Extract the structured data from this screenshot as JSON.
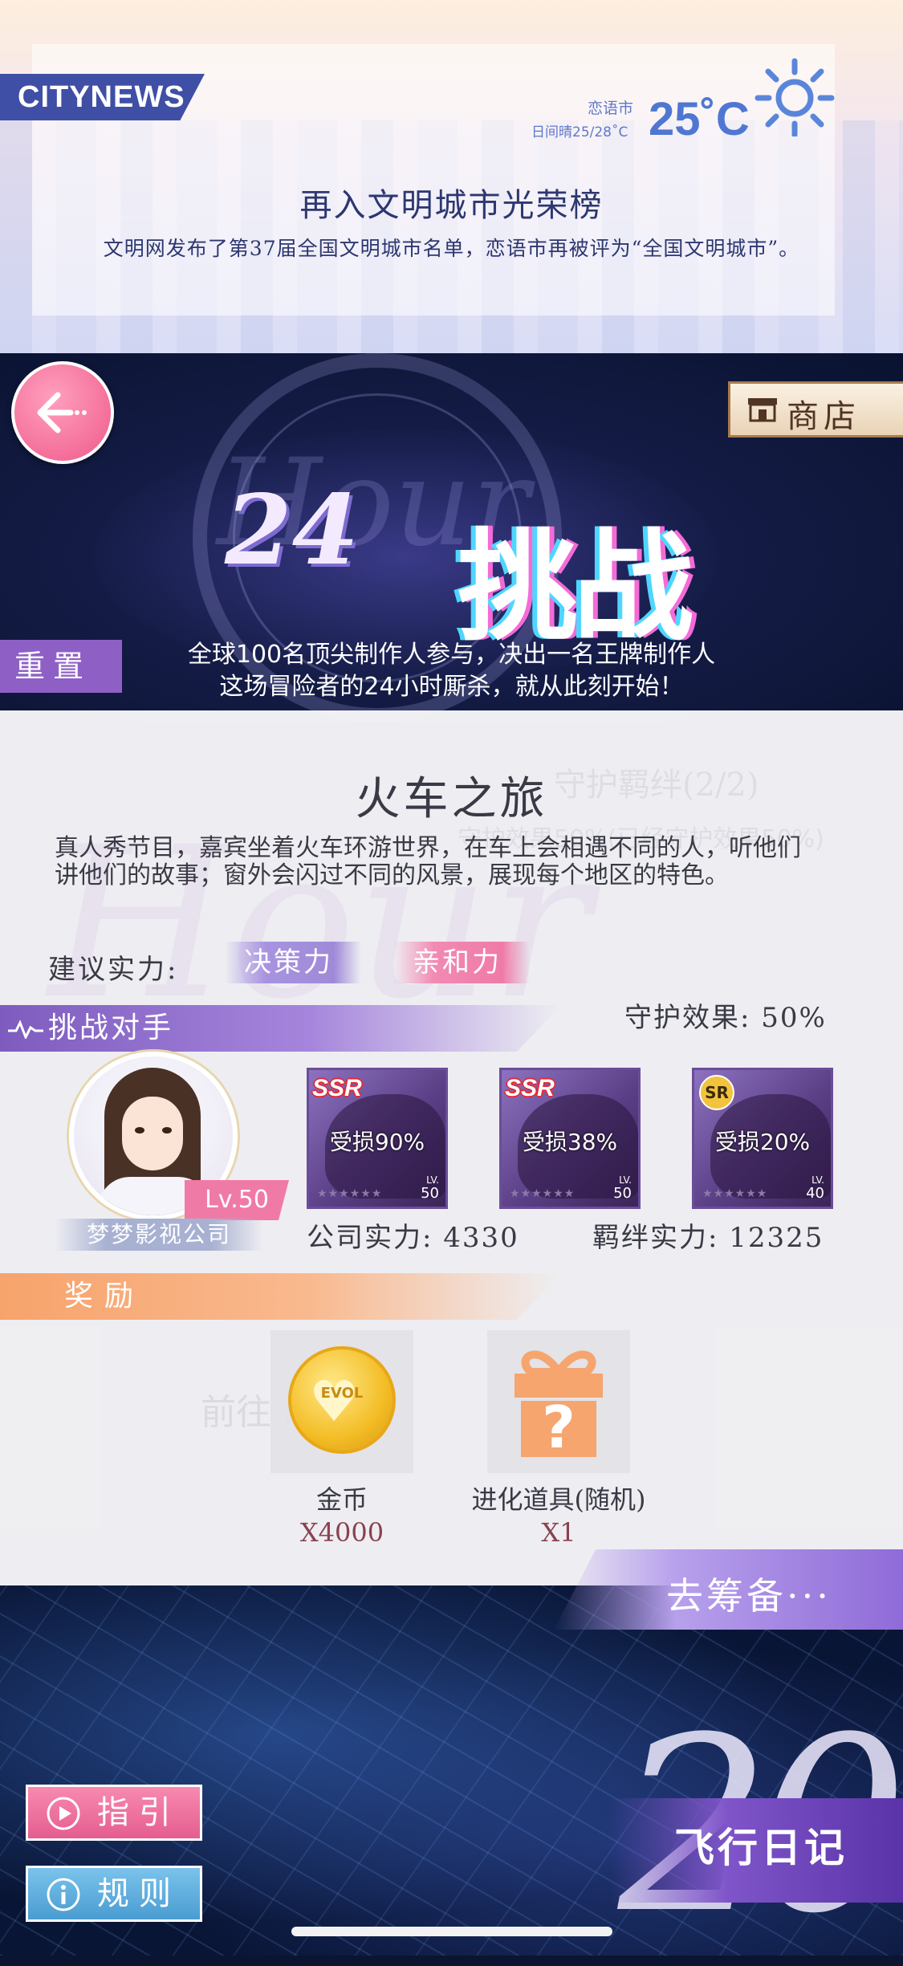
{
  "news": {
    "brand": "CITYNEWS",
    "city": "恋语市",
    "weather": "日间晴25/28˚C",
    "temperature": "25˚C",
    "weather_icon": "sun-icon",
    "headline": "再入文明城市光荣榜",
    "body": "文明网发布了第37届全国文明城市名单，恋语市再被评为“全国文明城市”。"
  },
  "hero": {
    "logo_number": "24",
    "logo_script": "Hour",
    "title": "挑战",
    "desc_line1": "全球100名顶尖制作人参与，决出一名王牌制作人",
    "desc_line2": "这场冒险者的24小时厮杀，就从此刻开始！"
  },
  "nav": {
    "back_icon": "back-arrow-icon",
    "shop_label": "商店",
    "shop_icon": "shop-icon",
    "reset_label": "重置"
  },
  "stage": {
    "title": "火车之旅",
    "description": "真人秀节目，嘉宾坐着火车环游世界，在车上会相遇不同的人，听他们讲他们的故事；窗外会闪过不同的风景，展现每个地区的特色。",
    "suggest_label": "建议实力:",
    "suggest_stats": [
      "决策力",
      "亲和力"
    ],
    "guard_effect": "守护效果:  50%",
    "ghost_text_1": "守护羁绊(2/2)",
    "ghost_text_2": "守护效果50%(已经守护效果50%)"
  },
  "opponent": {
    "section_label": "挑战对手",
    "level": "Lv.50",
    "company": "梦梦影视公司",
    "cards": [
      {
        "rarity": "SSR",
        "damage": "受损90%",
        "lv_label": "LV.",
        "level": "50",
        "stars": "★★★★★★"
      },
      {
        "rarity": "SSR",
        "damage": "受损38%",
        "lv_label": "LV.",
        "level": "50",
        "stars": "★★★★★★"
      },
      {
        "rarity": "SR",
        "damage": "受损20%",
        "lv_label": "LV.",
        "level": "40",
        "stars": "★★★★★★"
      }
    ],
    "company_power": "公司实力: 4330",
    "bond_power": "羁绊实力: 12325"
  },
  "rewards": {
    "section_label": "奖励",
    "items": [
      {
        "name": "金币",
        "qty": "X4000",
        "icon": "gold-coin-icon",
        "coin_text": "EVOL"
      },
      {
        "name": "进化道具(随机)",
        "qty": "X1",
        "icon": "mystery-gift-icon"
      }
    ],
    "ghost_text": "前往 ... 失"
  },
  "bottom": {
    "prepare_label": "去筹备···",
    "diary_label": "飞行日记",
    "diary_number": "20",
    "guide_label": "指引",
    "guide_icon": "play-circle-icon",
    "rules_label": "规则",
    "rules_icon": "info-circle-icon"
  },
  "colors": {
    "accent_pink": "#ef5a8b",
    "accent_purple": "#8e60c6",
    "reward_orange": "#f7a36c",
    "rules_blue": "#4a9cd1"
  }
}
